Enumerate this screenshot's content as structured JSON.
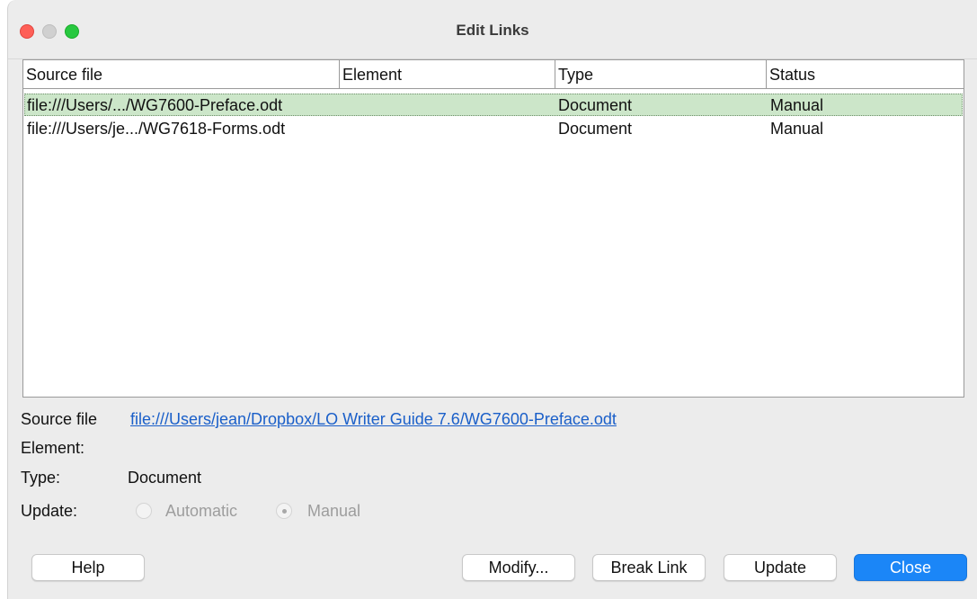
{
  "window": {
    "title": "Edit Links"
  },
  "links_table": {
    "columns": [
      "Source file",
      "Element",
      "Type",
      "Status"
    ],
    "rows": [
      {
        "source": "file:///Users/.../WG7600-Preface.odt",
        "element": "",
        "type": "Document",
        "status": "Manual",
        "selected": true
      },
      {
        "source": "file:///Users/je.../WG7618-Forms.odt",
        "element": "",
        "type": "Document",
        "status": "Manual",
        "selected": false
      }
    ]
  },
  "details": {
    "source_file_label": "Source file",
    "source_file_value": "file:///Users/jean/Dropbox/LO Writer Guide 7.6/WG7600-Preface.odt",
    "element_label": "Element:",
    "element_value": "",
    "type_label": "Type:",
    "type_value": "Document",
    "update_label": "Update:",
    "update_options": [
      {
        "label": "Automatic",
        "checked": false
      },
      {
        "label": "Manual",
        "checked": true
      }
    ]
  },
  "buttons": {
    "help": "Help",
    "modify": "Modify...",
    "break_link": "Break Link",
    "update": "Update",
    "close": "Close"
  },
  "colors": {
    "selection": "#cce6c9",
    "link": "#1a5fc9",
    "primary_button": "#1b86f7"
  }
}
